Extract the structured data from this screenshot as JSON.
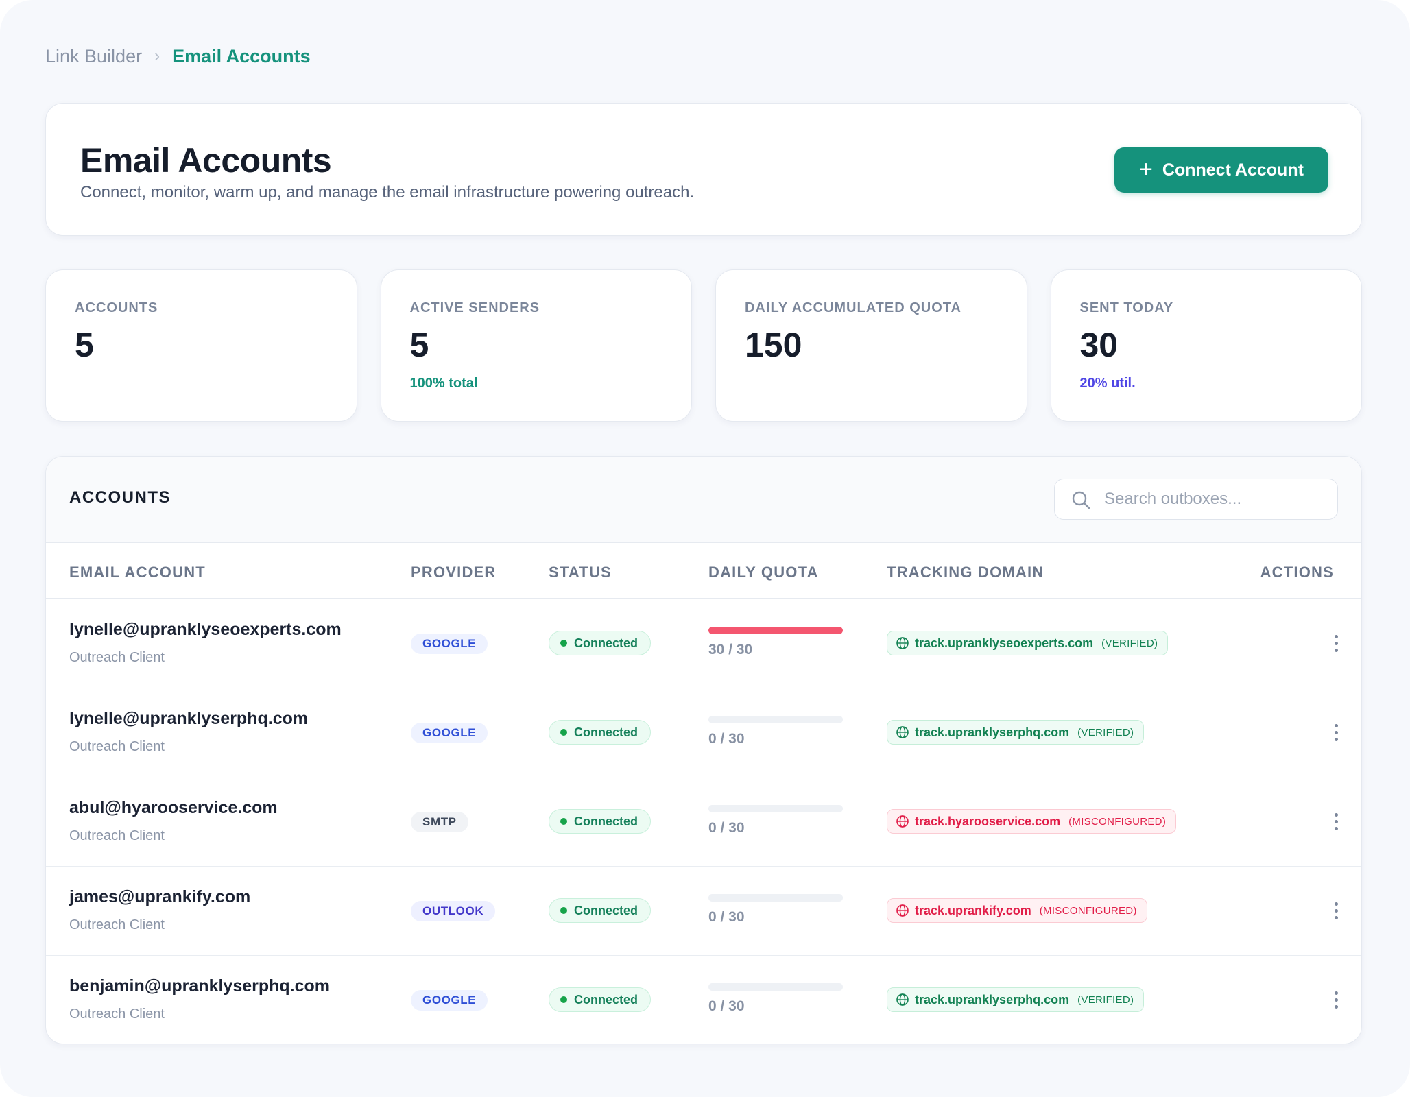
{
  "breadcrumb": {
    "parent": "Link Builder",
    "separator": "›",
    "current": "Email Accounts"
  },
  "header": {
    "title": "Email Accounts",
    "subtitle": "Connect, monitor, warm up, and manage the email infrastructure powering outreach.",
    "connect_button_label": "Connect Account",
    "connect_button_icon": "plus-icon"
  },
  "stats": [
    {
      "label": "ACCOUNTS",
      "value": "5",
      "sub": ""
    },
    {
      "label": "ACTIVE SENDERS",
      "value": "5",
      "sub": "100% total"
    },
    {
      "label": "DAILY ACCUMULATED QUOTA",
      "value": "150",
      "sub": ""
    },
    {
      "label": "SENT TODAY",
      "value": "30",
      "sub": "20% util."
    }
  ],
  "table": {
    "title": "ACCOUNTS",
    "search_placeholder": "Search outboxes...",
    "columns": [
      "EMAIL ACCOUNT",
      "PROVIDER",
      "STATUS",
      "DAILY QUOTA",
      "TRACKING DOMAIN",
      "ACTIONS"
    ],
    "rows": [
      {
        "email": "lynelle@upranklyseoexperts.com",
        "client": "Outreach Client",
        "provider": "GOOGLE",
        "status": "Connected",
        "quota_used": 30,
        "quota_max": 30,
        "quota_text": "30 / 30",
        "domain": "track.upranklyseoexperts.com",
        "domain_state": "(VERIFIED)"
      },
      {
        "email": "lynelle@upranklyserphq.com",
        "client": "Outreach Client",
        "provider": "GOOGLE",
        "status": "Connected",
        "quota_used": 0,
        "quota_max": 30,
        "quota_text": "0 / 30",
        "domain": "track.upranklyserphq.com",
        "domain_state": "(VERIFIED)"
      },
      {
        "email": "abul@hyarooservice.com",
        "client": "Outreach Client",
        "provider": "SMTP",
        "status": "Connected",
        "quota_used": 0,
        "quota_max": 30,
        "quota_text": "0 / 30",
        "domain": "track.hyarooservice.com",
        "domain_state": "(MISCONFIGURED)"
      },
      {
        "email": "james@uprankify.com",
        "client": "Outreach Client",
        "provider": "OUTLOOK",
        "status": "Connected",
        "quota_used": 0,
        "quota_max": 30,
        "quota_text": "0 / 30",
        "domain": "track.uprankify.com",
        "domain_state": "(MISCONFIGURED)"
      },
      {
        "email": "benjamin@upranklyserphq.com",
        "client": "Outreach Client",
        "provider": "GOOGLE",
        "status": "Connected",
        "quota_used": 0,
        "quota_max": 30,
        "quota_text": "0 / 30",
        "domain": "track.upranklyserphq.com",
        "domain_state": "(VERIFIED)"
      }
    ]
  },
  "icons": {
    "search": "search-icon",
    "globe": "globe-icon",
    "actions": "kebab-menu-icon",
    "chevron": "chevron-right-icon"
  },
  "colors": {
    "accent": "#15927c",
    "purple_text": "#4f46e5",
    "quota_fill": "#f4566f",
    "connected": "#16a34a",
    "verified": "#128152",
    "misconfigured": "#e11d48"
  }
}
